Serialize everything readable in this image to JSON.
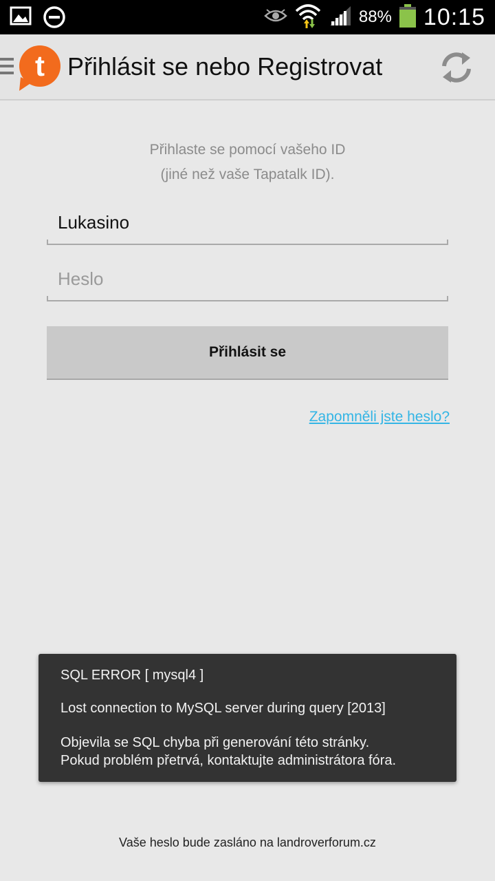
{
  "status_bar": {
    "icons": [
      "picture-icon",
      "do-not-disturb-icon",
      "eye-icon",
      "wifi-icon",
      "signal-icon",
      "battery-icon"
    ],
    "battery_percent": "88%",
    "time": "10:15"
  },
  "action_bar": {
    "title": "Přihlásit se nebo Registrovat",
    "logo_letter": "t"
  },
  "login": {
    "intro_line1": "Přihlaste se pomocí vašeho ID",
    "intro_line2": "(jiné než vaše Tapatalk ID).",
    "username_value": "Lukasino",
    "password_placeholder": "Heslo",
    "login_button": "Přihlásit se",
    "forgot_link": "Zapomněli jste heslo?"
  },
  "toast": {
    "title": "SQL ERROR [ mysql4 ]",
    "message": "Lost connection to MySQL server during query [2013]",
    "detail_line1": "Objevila se SQL chyba při generování této stránky.",
    "detail_line2": "Pokud problém přetrvá, kontaktujte administrátora fóra."
  },
  "footer": {
    "note": "Vaše heslo bude zasláno na landroverforum.cz"
  },
  "colors": {
    "accent_link": "#33b5e5",
    "logo_orange": "#f26b1d",
    "battery_green": "#8bc34a"
  }
}
